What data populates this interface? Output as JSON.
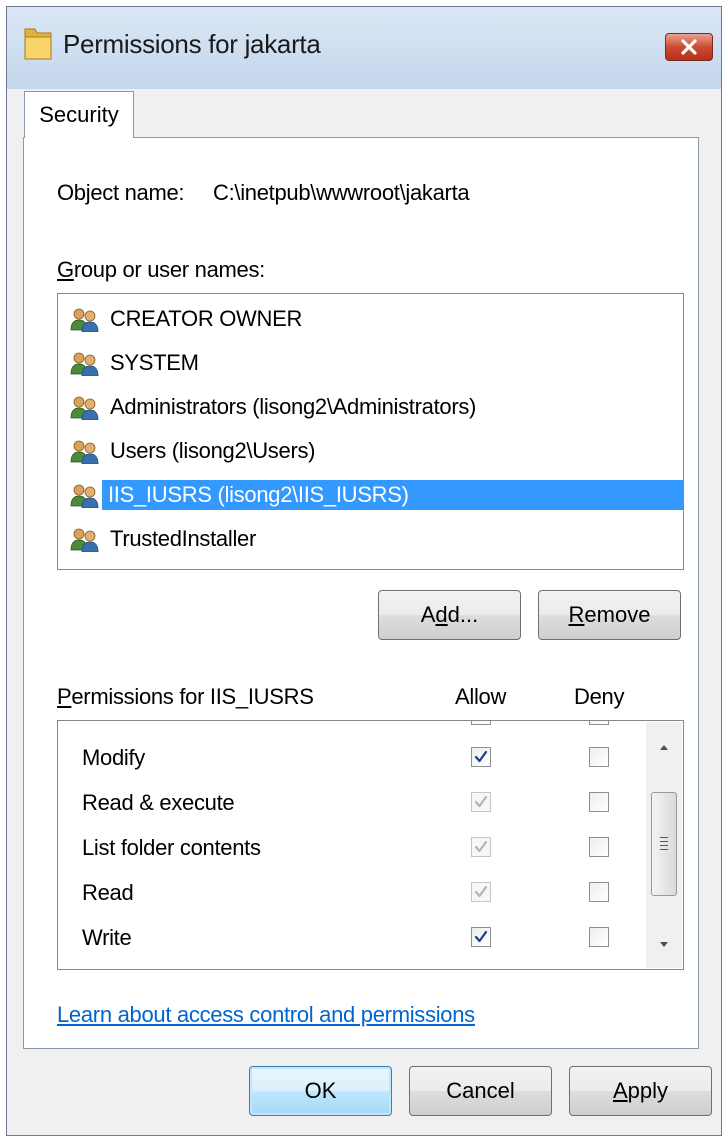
{
  "window": {
    "title": "Permissions for jakarta",
    "close_label": "✕"
  },
  "tabs": [
    {
      "label": "Security",
      "active": true
    }
  ],
  "object": {
    "label": "Object name:",
    "value": "C:\\inetpub\\wwwroot\\jakarta"
  },
  "group_users": {
    "label": "Group or user names:",
    "items": [
      {
        "name": "CREATOR OWNER",
        "selected": false
      },
      {
        "name": "SYSTEM",
        "selected": false
      },
      {
        "name": "Administrators (lisong2\\Administrators)",
        "selected": false
      },
      {
        "name": "Users (lisong2\\Users)",
        "selected": false
      },
      {
        "name": "IIS_IUSRS (lisong2\\IIS_IUSRS)",
        "selected": true
      },
      {
        "name": "TrustedInstaller",
        "selected": false
      }
    ]
  },
  "buttons": {
    "add": {
      "pre": "A",
      "acc": "d",
      "post": "d..."
    },
    "remove": {
      "pre": "",
      "acc": "R",
      "post": "emove"
    },
    "ok": "OK",
    "cancel": "Cancel",
    "apply": {
      "pre": "",
      "acc": "A",
      "post": "pply"
    }
  },
  "permissions": {
    "header": {
      "pre": "",
      "acc": "P",
      "post": "ermissions for IIS_IUSRS"
    },
    "allow_label": "Allow",
    "deny_label": "Deny",
    "rows": [
      {
        "name": "Modify",
        "allow": "checked",
        "deny": "unchecked"
      },
      {
        "name": "Read & execute",
        "allow": "checked-inherited",
        "deny": "unchecked"
      },
      {
        "name": "List folder contents",
        "allow": "checked-inherited",
        "deny": "unchecked"
      },
      {
        "name": "Read",
        "allow": "checked-inherited",
        "deny": "unchecked"
      },
      {
        "name": "Write",
        "allow": "checked",
        "deny": "unchecked"
      }
    ]
  },
  "link": "Learn about access control and permissions",
  "colors": {
    "selection": "#3399ff",
    "link": "#0066cc",
    "check_active": "#1b3f8b",
    "check_inherited": "#b4b4b4"
  }
}
